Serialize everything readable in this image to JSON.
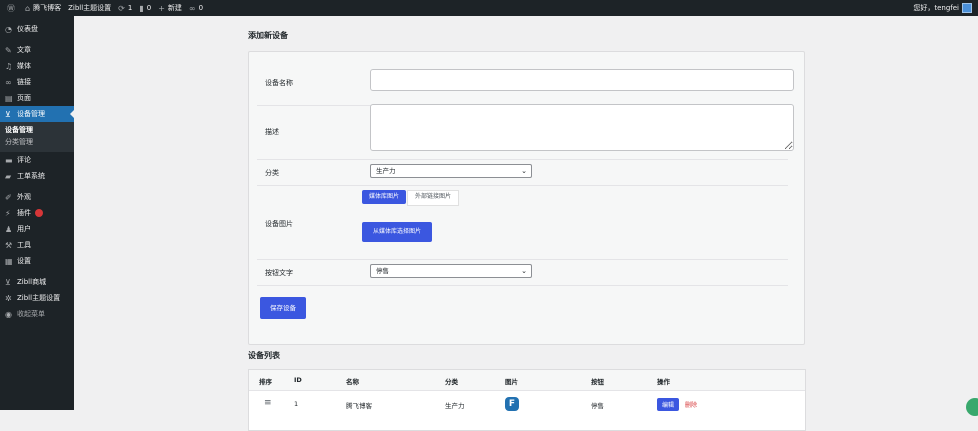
{
  "adminbar": {
    "site_name": "腾飞博客",
    "theme_settings": "Zibll主题设置",
    "updates": "1",
    "comments": "0",
    "new_label": "新建",
    "links_count": "0",
    "greeting": "您好，tengfei"
  },
  "sidebar": {
    "items": [
      {
        "label": "仪表盘",
        "icon": "dashboard-icon"
      },
      {
        "label": "文章",
        "icon": "pin-icon"
      },
      {
        "label": "媒体",
        "icon": "media-icon"
      },
      {
        "label": "链接",
        "icon": "link-icon"
      },
      {
        "label": "页面",
        "icon": "page-icon"
      },
      {
        "label": "设备管理",
        "icon": "cart-icon"
      },
      {
        "label": "评论",
        "icon": "comment-icon"
      },
      {
        "label": "工单系统",
        "icon": "ticket-icon"
      },
      {
        "label": "外观",
        "icon": "brush-icon"
      },
      {
        "label": "插件",
        "icon": "plugin-icon"
      },
      {
        "label": "用户",
        "icon": "user-icon"
      },
      {
        "label": "工具",
        "icon": "wrench-icon"
      },
      {
        "label": "设置",
        "icon": "settings-icon"
      },
      {
        "label": "Zibll商城",
        "icon": "cart-icon"
      },
      {
        "label": "Zibll主题设置",
        "icon": "gear-icon"
      }
    ],
    "submenu": [
      "设备管理",
      "分类管理"
    ],
    "collapse_label": "收起菜单"
  },
  "form": {
    "heading": "添加新设备",
    "name_label": "设备名称",
    "name_value": "",
    "desc_label": "描述",
    "desc_value": "",
    "category_label": "分类",
    "category_value": "生产力",
    "image_label": "设备图片",
    "tab_media": "媒体库图片",
    "tab_external": "外部链接图片",
    "choose_button": "从媒体库选择图片",
    "button_text_label": "按钮文字",
    "button_text_value": "停售",
    "save_button": "保存设备"
  },
  "list": {
    "heading": "设备列表",
    "columns": [
      "排序",
      "ID",
      "名称",
      "分类",
      "图片",
      "按钮",
      "操作"
    ],
    "rows": [
      {
        "id": "1",
        "name": "腾飞博客",
        "category": "生产力",
        "button": "停售",
        "edit": "编辑",
        "delete": "删除"
      }
    ]
  }
}
